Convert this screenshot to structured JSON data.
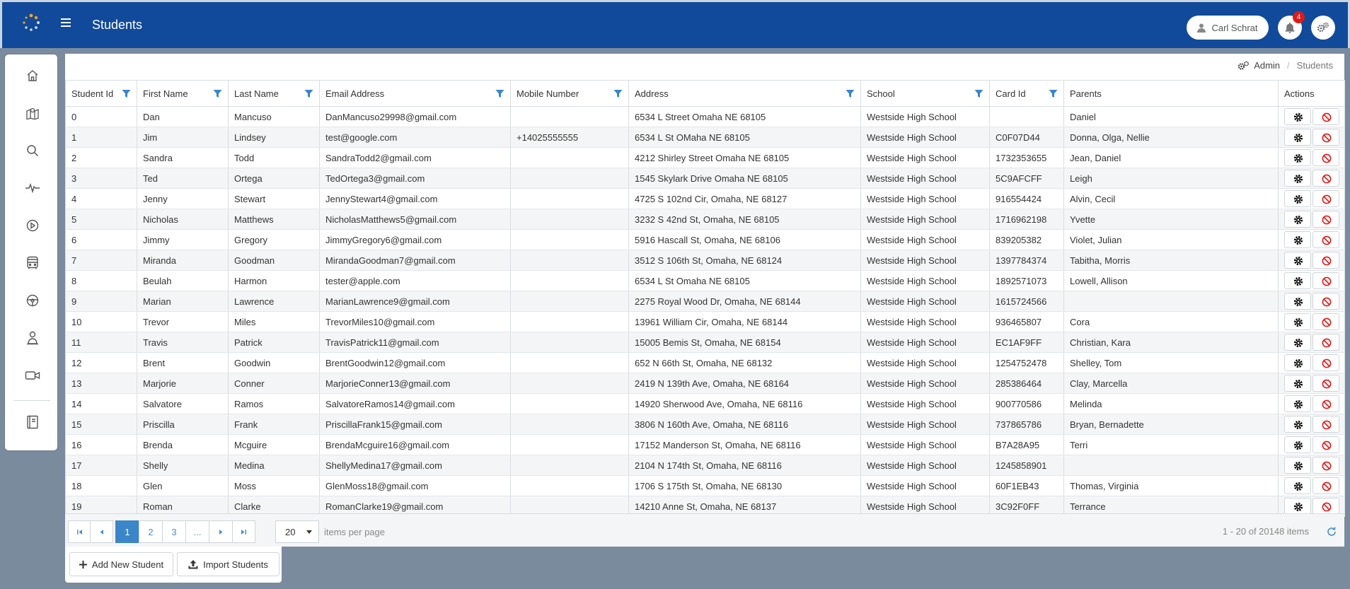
{
  "app": {
    "title": "Students"
  },
  "header": {
    "user_name": "Carl Schrat",
    "notification_count": "4"
  },
  "sidebar": {
    "items": [
      {
        "name": "home-icon"
      },
      {
        "name": "map-icon"
      },
      {
        "name": "search-icon"
      },
      {
        "name": "activity-icon"
      },
      {
        "name": "play-icon"
      },
      {
        "name": "bus-icon"
      },
      {
        "name": "steering-wheel-icon"
      },
      {
        "name": "driver-icon"
      },
      {
        "name": "video-icon"
      },
      {
        "name": "book-icon"
      }
    ]
  },
  "breadcrumb": {
    "admin": "Admin",
    "separator": "/",
    "current": "Students"
  },
  "table": {
    "columns": [
      "Student Id",
      "First Name",
      "Last Name",
      "Email Address",
      "Mobile Number",
      "Address",
      "School",
      "Card Id",
      "Parents",
      "Actions"
    ],
    "rows": [
      [
        "0",
        "Dan",
        "Mancuso",
        "DanMancuso29998@gmail.com",
        "",
        "6534 L Street Omaha NE 68105",
        "Westside High School",
        "",
        "Daniel"
      ],
      [
        "1",
        "Jim",
        "Lindsey",
        "test@google.com",
        "+14025555555",
        "6534 L St OMaha NE 68105",
        "Westside High School",
        "C0F07D44",
        "Donna, Olga, Nellie"
      ],
      [
        "2",
        "Sandra",
        "Todd",
        "SandraTodd2@gmail.com",
        "",
        "4212 Shirley Street Omaha NE 68105",
        "Westside High School",
        "1732353655",
        "Jean, Daniel"
      ],
      [
        "3",
        "Ted",
        "Ortega",
        "TedOrtega3@gmail.com",
        "",
        "1545 Skylark Drive Omaha NE 68105",
        "Westside High School",
        "5C9AFCFF",
        "Leigh"
      ],
      [
        "4",
        "Jenny",
        "Stewart",
        "JennyStewart4@gmail.com",
        "",
        "4725 S 102nd Cir, Omaha, NE 68127",
        "Westside High School",
        "916554424",
        "Alvin, Cecil"
      ],
      [
        "5",
        "Nicholas",
        "Matthews",
        "NicholasMatthews5@gmail.com",
        "",
        "3232 S 42nd St, Omaha, NE 68105",
        "Westside High School",
        "1716962198",
        "Yvette"
      ],
      [
        "6",
        "Jimmy",
        "Gregory",
        "JimmyGregory6@gmail.com",
        "",
        "5916 Hascall St, Omaha, NE 68106",
        "Westside High School",
        "839205382",
        "Violet, Julian"
      ],
      [
        "7",
        "Miranda",
        "Goodman",
        "MirandaGoodman7@gmail.com",
        "",
        "3512 S 106th St, Omaha, NE 68124",
        "Westside High School",
        "1397784374",
        "Tabitha, Morris"
      ],
      [
        "8",
        "Beulah",
        "Harmon",
        "tester@apple.com",
        "",
        "6534 L St Omaha NE 68105",
        "Westside High School",
        "1892571073",
        "Lowell, Allison"
      ],
      [
        "9",
        "Marian",
        "Lawrence",
        "MarianLawrence9@gmail.com",
        "",
        "2275 Royal Wood Dr, Omaha, NE 68144",
        "Westside High School",
        "1615724566",
        ""
      ],
      [
        "10",
        "Trevor",
        "Miles",
        "TrevorMiles10@gmail.com",
        "",
        "13961 William Cir, Omaha, NE 68144",
        "Westside High School",
        "936465807",
        "Cora"
      ],
      [
        "11",
        "Travis",
        "Patrick",
        "TravisPatrick11@gmail.com",
        "",
        "15005 Bemis St, Omaha, NE 68154",
        "Westside High School",
        "EC1AF9FF",
        "Christian, Kara"
      ],
      [
        "12",
        "Brent",
        "Goodwin",
        "BrentGoodwin12@gmail.com",
        "",
        "652 N 66th St, Omaha, NE 68132",
        "Westside High School",
        "1254752478",
        "Shelley, Tom"
      ],
      [
        "13",
        "Marjorie",
        "Conner",
        "MarjorieConner13@gmail.com",
        "",
        "2419 N 139th Ave, Omaha, NE 68164",
        "Westside High School",
        "285386464",
        "Clay, Marcella"
      ],
      [
        "14",
        "Salvatore",
        "Ramos",
        "SalvatoreRamos14@gmail.com",
        "",
        "14920 Sherwood Ave, Omaha, NE 68116",
        "Westside High School",
        "900770586",
        "Melinda"
      ],
      [
        "15",
        "Priscilla",
        "Frank",
        "PriscillaFrank15@gmail.com",
        "",
        "3806 N 160th Ave, Omaha, NE 68116",
        "Westside High School",
        "737865786",
        "Bryan, Bernadette"
      ],
      [
        "16",
        "Brenda",
        "Mcguire",
        "BrendaMcguire16@gmail.com",
        "",
        "17152 Manderson St, Omaha, NE 68116",
        "Westside High School",
        "B7A28A95",
        "Terri"
      ],
      [
        "17",
        "Shelly",
        "Medina",
        "ShellyMedina17@gmail.com",
        "",
        "2104 N 174th St, Omaha, NE 68116",
        "Westside High School",
        "1245858901",
        ""
      ],
      [
        "18",
        "Glen",
        "Moss",
        "GlenMoss18@gmail.com",
        "",
        "1706 S 175th St, Omaha, NE 68130",
        "Westside High School",
        "60F1EB43",
        "Thomas, Virginia"
      ],
      [
        "19",
        "Roman",
        "Clarke",
        "RomanClarke19@gmail.com",
        "",
        "14210 Anne St, Omaha, NE 68137",
        "Westside High School",
        "3C92F0FF",
        "Terrance"
      ]
    ]
  },
  "pagination": {
    "pages": [
      "1",
      "2",
      "3",
      "..."
    ],
    "current_page": "1",
    "per_page": "20",
    "per_page_label": "items per page",
    "info": "1 - 20 of 20148 items"
  },
  "actions": {
    "add_label": "Add New Student",
    "import_label": "Import Students"
  },
  "colors": {
    "header_bg": "#114a9a",
    "accent": "#3a86c8",
    "danger": "#e01a1a",
    "page_bg": "#7b8b9e"
  }
}
